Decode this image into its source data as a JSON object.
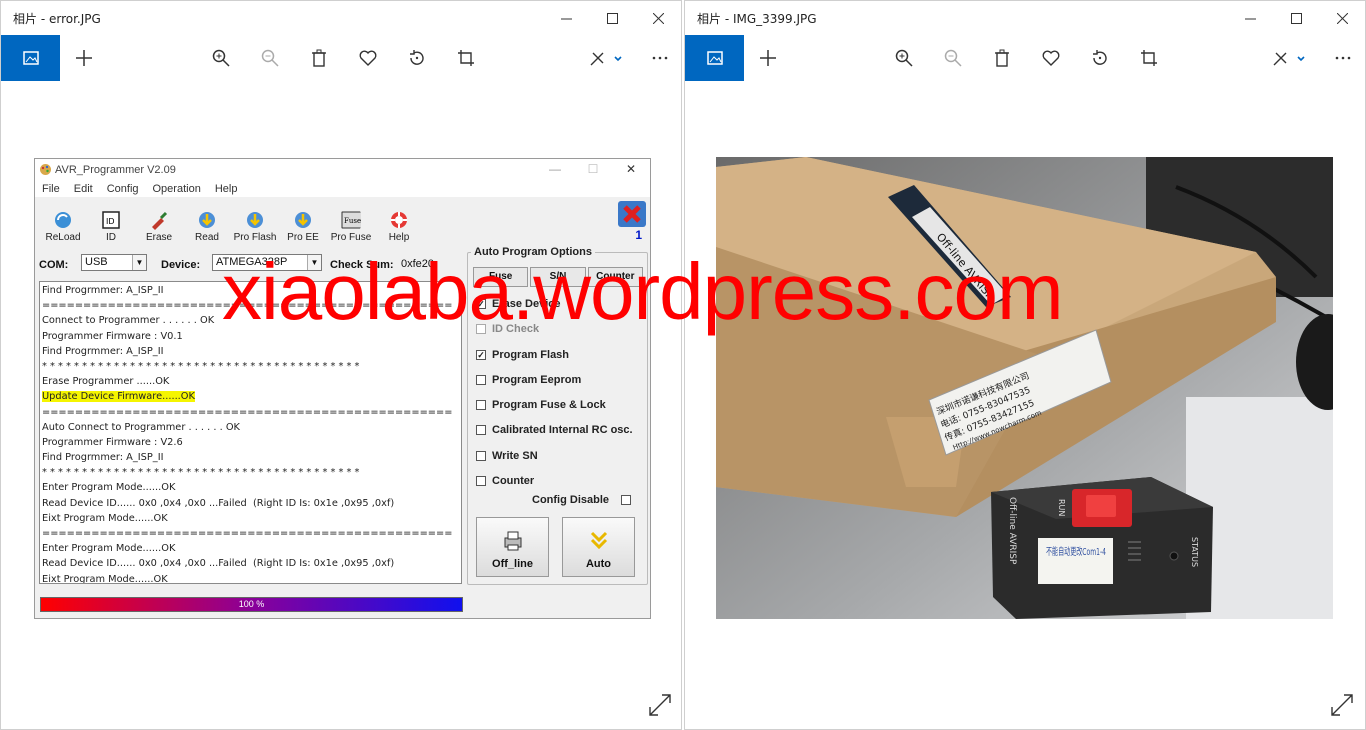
{
  "left_window": {
    "title": "相片 - error.JPG",
    "toolbar_icons": [
      "photo-icon",
      "add-icon",
      "zoom-in-icon",
      "zoom-out-icon",
      "delete-icon",
      "heart-icon",
      "rotate-icon",
      "crop-icon",
      "edit-icon",
      "more-icon"
    ]
  },
  "right_window": {
    "title": "相片 - IMG_3399.JPG",
    "toolbar_icons": [
      "photo-icon",
      "add-icon",
      "zoom-in-icon",
      "zoom-out-icon",
      "delete-icon",
      "heart-icon",
      "rotate-icon",
      "crop-icon",
      "edit-icon",
      "more-icon"
    ]
  },
  "avr": {
    "title": "AVR_Programmer V2.09",
    "menu": [
      "File",
      "Edit",
      "Config",
      "Operation",
      "Help"
    ],
    "tools": [
      "ReLoad",
      "ID",
      "Erase",
      "Read",
      "Pro Flash",
      "Pro EE",
      "Pro Fuse",
      "Help"
    ],
    "fuse_icon_text": "Fuse",
    "id_icon_text": "ID",
    "error_badge_count": "1",
    "com_label": "COM:",
    "com_value": "USB",
    "device_label": "Device:",
    "device_value": "ATMEGA328P",
    "checksum_label": "Check Sum:",
    "checksum_value": "0xfe20",
    "log_lines": [
      "Find Progrmmer: A_ISP_II",
      "==================================================",
      "Connect to Programmer . . . . . . OK",
      "Programmer Firmware : V0.1",
      "Find Progrmmer: A_ISP_II",
      "* * * * * * * * * * * * * * * * * * * * * * * * * * * * * * * * * * * * * * * *",
      "Erase Programmer ......OK",
      "Update Device Firmware......OK",
      "==================================================",
      "Auto Connect to Programmer . . . . . . OK",
      "Programmer Firmware : V2.6",
      "Find Progrmmer: A_ISP_II",
      "* * * * * * * * * * * * * * * * * * * * * * * * * * * * * * * * * * * * * * * *",
      "Enter Program Mode......OK",
      "Read Device ID...... 0x0 ,0x4 ,0x0 ...Failed  (Right ID Is: 0x1e ,0x95 ,0xf)",
      "Eixt Program Mode......OK",
      "==================================================",
      "Enter Program Mode......OK",
      "Read Device ID...... 0x0 ,0x4 ,0x0 ...Failed  (Right ID Is: 0x1e ,0x95 ,0xf)",
      "Eixt Program Mode......OK"
    ],
    "auto_options_title": "Auto Program Options",
    "tab_buttons": [
      "Fuse",
      "S/N",
      "Counter"
    ],
    "options": [
      {
        "label": "Erase Device",
        "checked": true
      },
      {
        "label": "ID Check",
        "checked": false
      },
      {
        "label": "Program Flash",
        "checked": true
      },
      {
        "label": "Program Eeprom",
        "checked": false
      },
      {
        "label": "Program Fuse & Lock",
        "checked": false
      },
      {
        "label": "Calibrated Internal RC osc.",
        "checked": false
      },
      {
        "label": "Write SN",
        "checked": false
      },
      {
        "label": "Counter",
        "checked": false
      }
    ],
    "config_disable_label": "Config Disable",
    "offline_label": "Off_line",
    "auto_label": "Auto",
    "progress_text": "100 %",
    "progress_percent": 100
  },
  "photo": {
    "tag_text": "Off-line AVRISP",
    "box_label_company": "深圳市诺谦科技有限公司",
    "box_label_tel": "电话: 0755-83047535",
    "box_label_fax": "传真: 0755-83427155",
    "box_label_web": "Http://www.nowcharm.com",
    "device_label_main": "Off-line AVRISP",
    "device_label_run": "RUN",
    "device_label_status": "STATUS",
    "sticker_text": "不能自动更改Com1-4"
  },
  "watermark": "xiaolaba.wordpress.com",
  "colors": {
    "accent": "#0067c0",
    "watermark": "#ff0000",
    "highlight": "#f5f500"
  }
}
